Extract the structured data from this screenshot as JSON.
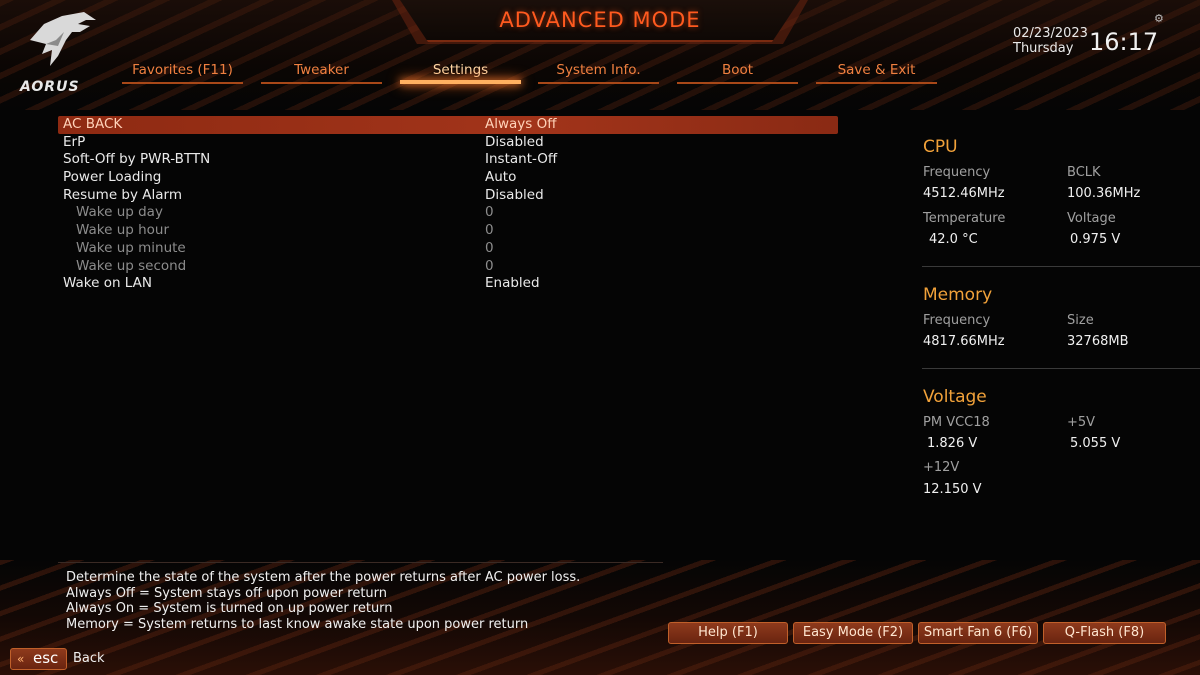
{
  "header": {
    "title": "ADVANCED MODE",
    "logo_text": "AORUS",
    "date": "02/23/2023",
    "day": "Thursday",
    "time": "16:17",
    "settings_icon": "gear-icon"
  },
  "tabs": [
    {
      "label": "Favorites (F11)",
      "active": false
    },
    {
      "label": "Tweaker",
      "active": false
    },
    {
      "label": "Settings",
      "active": true
    },
    {
      "label": "System Info.",
      "active": false
    },
    {
      "label": "Boot",
      "active": false
    },
    {
      "label": "Save & Exit",
      "active": false
    }
  ],
  "settings": [
    {
      "label": "AC BACK",
      "value": "Always Off",
      "selected": true
    },
    {
      "label": "ErP",
      "value": "Disabled"
    },
    {
      "label": "Soft-Off by PWR-BTTN",
      "value": "Instant-Off"
    },
    {
      "label": "Power Loading",
      "value": "Auto"
    },
    {
      "label": "Resume by Alarm",
      "value": "Disabled"
    },
    {
      "label": "Wake up day",
      "value": "0",
      "sub": true
    },
    {
      "label": "Wake up hour",
      "value": "0",
      "sub": true
    },
    {
      "label": "Wake up minute",
      "value": "0",
      "sub": true
    },
    {
      "label": "Wake up second",
      "value": "0",
      "sub": true
    },
    {
      "label": "Wake on LAN",
      "value": "Enabled"
    }
  ],
  "cpu": {
    "title": "CPU",
    "freq_label": "Frequency",
    "freq_value": "4512.46MHz",
    "bclk_label": "BCLK",
    "bclk_value": "100.36MHz",
    "temp_label": "Temperature",
    "temp_value": "42.0 °C",
    "volt_label": "Voltage",
    "volt_value": "0.975 V"
  },
  "memory": {
    "title": "Memory",
    "freq_label": "Frequency",
    "freq_value": "4817.66MHz",
    "size_label": "Size",
    "size_value": "32768MB"
  },
  "voltage": {
    "title": "Voltage",
    "pmvcc18_label": "PM VCC18",
    "pmvcc18_value": "1.826 V",
    "v5_label": "+5V",
    "v5_value": "5.055 V",
    "v12_label": "+12V",
    "v12_value": "12.150 V"
  },
  "description": [
    "Determine the state of  the system after the power returns after AC power loss.",
    "Always Off = System stays off upon power return",
    "Always On = System is turned on up power return",
    "Memory = System returns to last know awake state upon power return"
  ],
  "footer": {
    "help": "Help (F1)",
    "easy_mode": "Easy Mode (F2)",
    "smart_fan": "Smart Fan 6 (F6)",
    "qflash": "Q-Flash (F8)",
    "esc_label": "esc",
    "back_label": "Back"
  },
  "colors": {
    "accent": "#ff5a1f",
    "section_title": "#f2a23a",
    "selected_row": "#a2341a"
  }
}
